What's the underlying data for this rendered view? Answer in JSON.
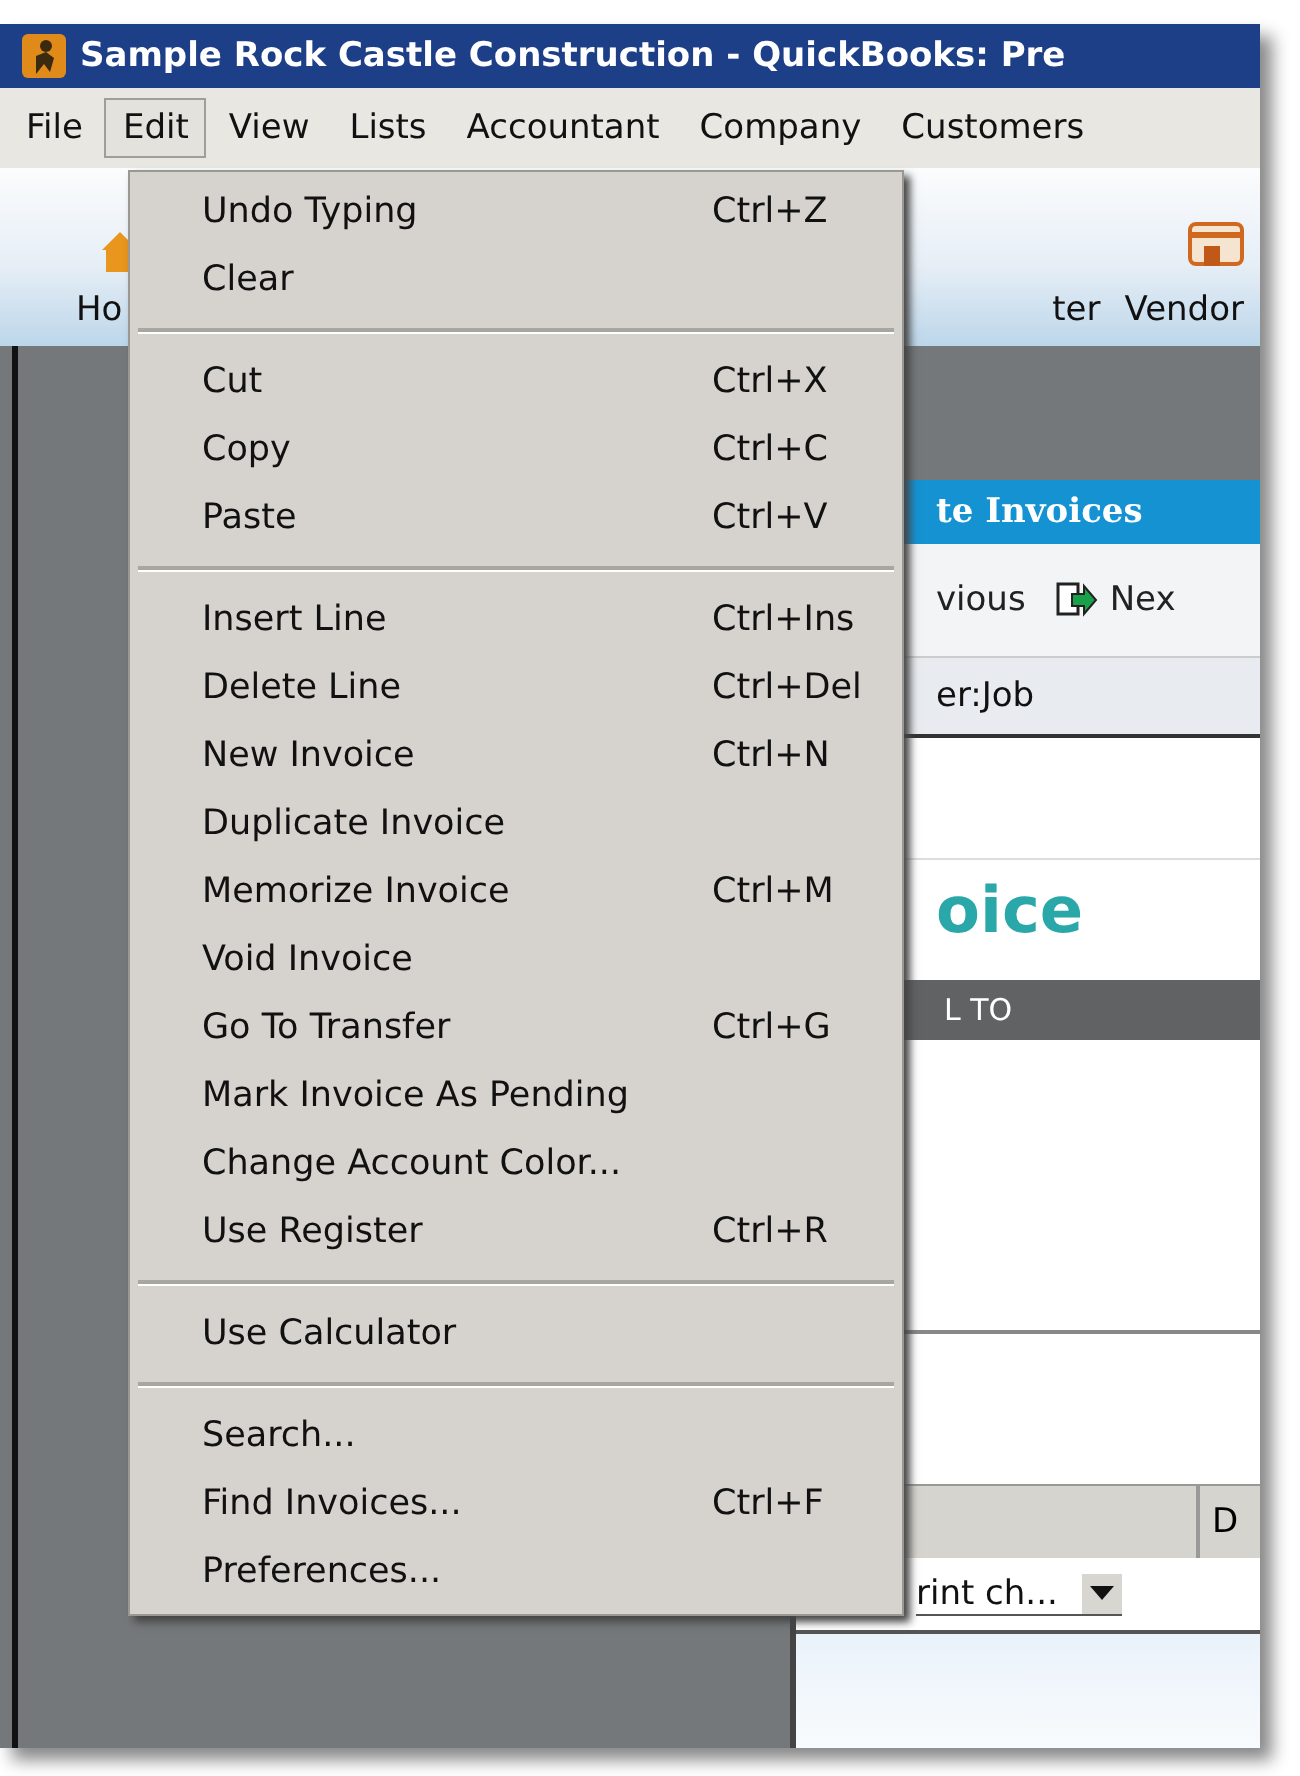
{
  "window": {
    "title": "Sample Rock Castle Construction  - QuickBooks: Pre"
  },
  "menu_bar": [
    {
      "label": "File",
      "selected": false
    },
    {
      "label": "Edit",
      "selected": true
    },
    {
      "label": "View",
      "selected": false
    },
    {
      "label": "Lists",
      "selected": false
    },
    {
      "label": "Accountant",
      "selected": false
    },
    {
      "label": "Company",
      "selected": false
    },
    {
      "label": "Customers",
      "selected": false
    }
  ],
  "toolbar": {
    "left_label": "Ho",
    "right_labels": [
      "ter",
      "Vendor"
    ]
  },
  "edit_menu": {
    "groups": [
      [
        {
          "label": "Undo Typing",
          "shortcut": "Ctrl+Z"
        },
        {
          "label": "Clear"
        }
      ],
      [
        {
          "label": "Cut",
          "shortcut": "Ctrl+X"
        },
        {
          "label": "Copy",
          "shortcut": "Ctrl+C"
        },
        {
          "label": "Paste",
          "shortcut": "Ctrl+V"
        }
      ],
      [
        {
          "label": "Insert Line",
          "shortcut": "Ctrl+Ins"
        },
        {
          "label": "Delete Line",
          "shortcut": "Ctrl+Del"
        },
        {
          "label": "New Invoice",
          "shortcut": "Ctrl+N"
        },
        {
          "label": "Duplicate Invoice"
        },
        {
          "label": "Memorize Invoice",
          "shortcut": "Ctrl+M"
        },
        {
          "label": "Void Invoice"
        },
        {
          "label": "Go To Transfer",
          "shortcut": "Ctrl+G"
        },
        {
          "label": "Mark Invoice As Pending"
        },
        {
          "label": "Change Account Color..."
        },
        {
          "label": "Use Register",
          "shortcut": "Ctrl+R"
        }
      ],
      [
        {
          "label": "Use Calculator"
        }
      ],
      [
        {
          "label": "Search..."
        },
        {
          "label": "Find Invoices...",
          "shortcut": "Ctrl+F"
        },
        {
          "label": "Preferences..."
        }
      ]
    ]
  },
  "invoice_window": {
    "title": "te Invoices",
    "previous_button": "vious",
    "next_button": "Nex",
    "customer_label": "er:Job",
    "heading": "oice",
    "bill_to": "L TO",
    "column_1": "D",
    "template_field": "rint ch..."
  }
}
